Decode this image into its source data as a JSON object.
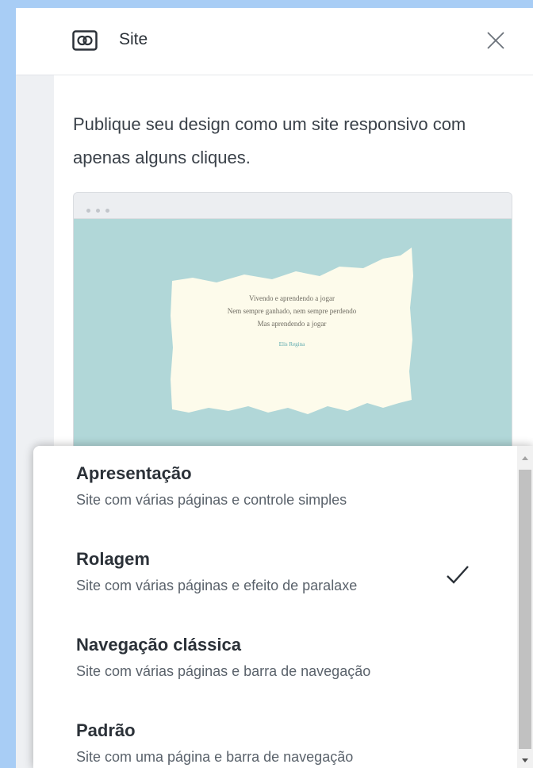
{
  "panel": {
    "title": "Site",
    "description": "Publique seu design como um site responsivo com apenas alguns cliques."
  },
  "icons": {
    "site": "site-icon",
    "close": "close-icon",
    "check": "checkmark-icon",
    "scroll_up": "scroll-up-arrow-icon",
    "scroll_down": "scroll-down-arrow-icon"
  },
  "preview": {
    "poem_line_1": "Vivendo e aprendendo a jogar",
    "poem_line_2": "Nem sempre ganhado, nem sempre perdendo",
    "poem_line_3": "Mas aprendendo a jogar",
    "signature": "Elis Regina"
  },
  "options": [
    {
      "name": "Apresentação",
      "description": "Site com várias páginas e controle simples",
      "selected": false
    },
    {
      "name": "Rolagem",
      "description": "Site com várias páginas e efeito de paralaxe",
      "selected": true
    },
    {
      "name": "Navegação clássica",
      "description": "Site com várias páginas e barra de navegação",
      "selected": false
    },
    {
      "name": "Padrão",
      "description": "Site com uma página e barra de navegação",
      "selected": false
    }
  ],
  "colors": {
    "background": "#a8cdf5",
    "preview_bg": "#b1d7d8",
    "paper": "#fdfbeb",
    "text": "#2b3138"
  }
}
